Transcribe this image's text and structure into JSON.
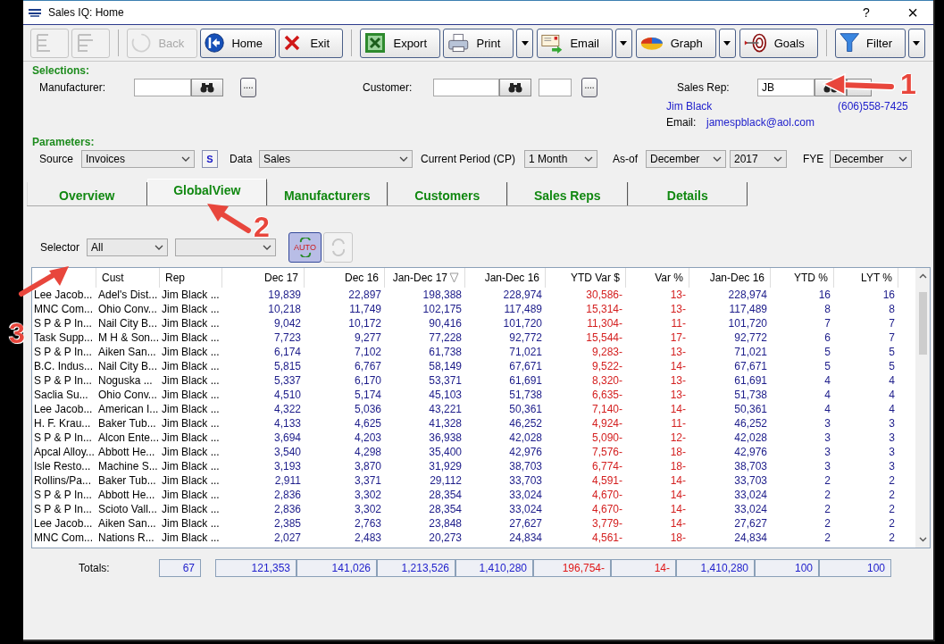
{
  "window": {
    "title": "Sales IQ: Home",
    "help": "?",
    "close": "×"
  },
  "toolbar": [
    {
      "kind": "button",
      "disabled": true,
      "menu": false
    },
    {
      "kind": "button",
      "disabled": true,
      "menu": false
    },
    {
      "kind": "separator"
    },
    {
      "kind": "button",
      "label": "Back",
      "disabled": true,
      "menu": false
    },
    {
      "kind": "button",
      "label": "Home",
      "disabled": false,
      "menu": false
    },
    {
      "kind": "button",
      "label": "Exit",
      "disabled": false,
      "menu": false
    },
    {
      "kind": "separator"
    },
    {
      "kind": "button",
      "label": "Export",
      "disabled": false,
      "menu": false
    },
    {
      "kind": "button",
      "label": "Print",
      "disabled": false,
      "menu": true
    },
    {
      "kind": "button",
      "label": "Email",
      "disabled": false,
      "menu": true
    },
    {
      "kind": "button",
      "label": "Graph",
      "disabled": false,
      "menu": true
    },
    {
      "kind": "button",
      "label": "Goals",
      "disabled": false,
      "menu": false
    },
    {
      "kind": "separator"
    },
    {
      "kind": "button",
      "label": "Filter",
      "disabled": false,
      "menu": true
    }
  ],
  "selections": {
    "title": "Selections:",
    "manufacturer": {
      "label": "Manufacturer:",
      "more": "...."
    },
    "customer": {
      "label": "Customer:",
      "more": "...."
    },
    "sales_rep": {
      "label": "Sales Rep:",
      "value": "JB"
    },
    "rep_name": "Jim Black",
    "rep_phone": "(606)558-7425",
    "email_label": "Email:",
    "email": "jamespblack@aol.com"
  },
  "parameters": {
    "title": "Parameters:",
    "fields": [
      {
        "kind": "select",
        "label": "Source",
        "value": "Invoices"
      },
      {
        "kind": "button",
        "label": "S"
      },
      {
        "kind": "select",
        "label": "Data",
        "value": "Sales"
      },
      {
        "kind": "select",
        "label": "Current Period (CP)",
        "value": "1 Month"
      },
      {
        "kind": "select",
        "label": "As-of",
        "value": "December"
      },
      {
        "kind": "select",
        "value": "2017"
      },
      {
        "kind": "select",
        "label": "FYE",
        "value": "December"
      }
    ]
  },
  "tabs": [
    {
      "label": "Overview",
      "selected": false
    },
    {
      "label": "GlobalView",
      "selected": true
    },
    {
      "label": "Manufacturers",
      "selected": false
    },
    {
      "label": "Customers",
      "selected": false
    },
    {
      "label": "Sales Reps",
      "selected": false
    },
    {
      "label": "Details",
      "selected": false
    }
  ],
  "selector": {
    "label": "Selector",
    "value": "All",
    "auto": {
      "label": "AUTO",
      "pressed": true
    },
    "refresh": {
      "disabled": true
    }
  },
  "table": {
    "columns": [
      {
        "kind": "text"
      },
      {
        "kind": "text",
        "label": "Cust",
        "sorted": false
      },
      {
        "kind": "text",
        "label": "Rep",
        "sorted": false
      },
      {
        "kind": "number",
        "label": "Dec 17",
        "sorted": false
      },
      {
        "kind": "number",
        "label": "Dec 16",
        "sorted": false
      },
      {
        "kind": "number",
        "label": "Jan-Dec 17",
        "sorted": true
      },
      {
        "kind": "number",
        "label": "Jan-Dec 16",
        "sorted": false
      },
      {
        "kind": "variance",
        "label": "YTD Var $",
        "sorted": false
      },
      {
        "kind": "variance",
        "label": "Var %",
        "sorted": false
      },
      {
        "kind": "number",
        "label": "Jan-Dec 16",
        "sorted": false
      },
      {
        "kind": "number",
        "label": "YTD %",
        "sorted": false
      },
      {
        "kind": "number",
        "label": "LYT %",
        "sorted": false
      }
    ],
    "rows": [
      [
        "Lee Jacob...",
        "Adel's Dist...",
        "Jim Black ...",
        "19,839",
        "22,897",
        "198,388",
        "228,974",
        "30,586-",
        "13-",
        "228,974",
        "16",
        "16"
      ],
      [
        "MNC Com...",
        "Ohio Conv...",
        "Jim Black ...",
        "10,218",
        "11,749",
        "102,175",
        "117,489",
        "15,314-",
        "13-",
        "117,489",
        "8",
        "8"
      ],
      [
        "S P & P In...",
        "Nail City B...",
        "Jim Black ...",
        "9,042",
        "10,172",
        "90,416",
        "101,720",
        "11,304-",
        "11-",
        "101,720",
        "7",
        "7"
      ],
      [
        "Task Supp...",
        "M H & Son...",
        "Jim Black ...",
        "7,723",
        "9,277",
        "77,228",
        "92,772",
        "15,544-",
        "17-",
        "92,772",
        "6",
        "7"
      ],
      [
        "S P & P In...",
        "Aiken San...",
        "Jim Black ...",
        "6,174",
        "7,102",
        "61,738",
        "71,021",
        "9,283-",
        "13-",
        "71,021",
        "5",
        "5"
      ],
      [
        "B.C. Indus...",
        "Nail City B...",
        "Jim Black ...",
        "5,815",
        "6,767",
        "58,149",
        "67,671",
        "9,522-",
        "14-",
        "67,671",
        "5",
        "5"
      ],
      [
        "S P & P In...",
        "Noguska  ...",
        "Jim Black ...",
        "5,337",
        "6,170",
        "53,371",
        "61,691",
        "8,320-",
        "13-",
        "61,691",
        "4",
        "4"
      ],
      [
        "Saclia Su...",
        "Ohio Conv...",
        "Jim Black ...",
        "4,510",
        "5,174",
        "45,103",
        "51,738",
        "6,635-",
        "13-",
        "51,738",
        "4",
        "4"
      ],
      [
        "Lee Jacob...",
        "American I...",
        "Jim Black ...",
        "4,322",
        "5,036",
        "43,221",
        "50,361",
        "7,140-",
        "14-",
        "50,361",
        "4",
        "4"
      ],
      [
        "H. F. Krau...",
        "Baker Tub...",
        "Jim Black ...",
        "4,133",
        "4,625",
        "41,328",
        "46,252",
        "4,924-",
        "11-",
        "46,252",
        "3",
        "3"
      ],
      [
        "S P & P In...",
        "Alcon Ente...",
        "Jim Black ...",
        "3,694",
        "4,203",
        "36,938",
        "42,028",
        "5,090-",
        "12-",
        "42,028",
        "3",
        "3"
      ],
      [
        "Apcal Alloy...",
        "Abbott He...",
        "Jim Black ...",
        "3,540",
        "4,298",
        "35,400",
        "42,976",
        "7,576-",
        "18-",
        "42,976",
        "3",
        "3"
      ],
      [
        "Isle Resto...",
        "Machine S...",
        "Jim Black ...",
        "3,193",
        "3,870",
        "31,929",
        "38,703",
        "6,774-",
        "18-",
        "38,703",
        "3",
        "3"
      ],
      [
        "Rollins/Pa...",
        "Baker Tub...",
        "Jim Black ...",
        "2,911",
        "3,371",
        "29,112",
        "33,703",
        "4,591-",
        "14-",
        "33,703",
        "2",
        "2"
      ],
      [
        "S P & P In...",
        "Abbott He...",
        "Jim Black ...",
        "2,836",
        "3,302",
        "28,354",
        "33,024",
        "4,670-",
        "14-",
        "33,024",
        "2",
        "2"
      ],
      [
        "S P & P In...",
        "Scioto Vall...",
        "Jim Black ...",
        "2,836",
        "3,302",
        "28,354",
        "33,024",
        "4,670-",
        "14-",
        "33,024",
        "2",
        "2"
      ],
      [
        "Lee Jacob...",
        "Aiken San...",
        "Jim Black ...",
        "2,385",
        "2,763",
        "23,848",
        "27,627",
        "3,779-",
        "14-",
        "27,627",
        "2",
        "2"
      ],
      [
        "MNC Com...",
        "Nations R...",
        "Jim Black ...",
        "2,027",
        "2,483",
        "20,273",
        "24,834",
        "4,561-",
        "18-",
        "24,834",
        "2",
        "2"
      ]
    ]
  },
  "totals": {
    "label": "Totals:",
    "count": "67",
    "cells": [
      {
        "kind": "number",
        "value": "121,353"
      },
      {
        "kind": "number",
        "value": "141,026"
      },
      {
        "kind": "number",
        "value": "1,213,526"
      },
      {
        "kind": "number",
        "value": "1,410,280"
      },
      {
        "kind": "variance",
        "value": "196,754-"
      },
      {
        "kind": "variance",
        "value": "14-"
      },
      {
        "kind": "number",
        "value": "1,410,280"
      },
      {
        "kind": "number",
        "value": "100"
      },
      {
        "kind": "number",
        "value": "100"
      }
    ]
  },
  "annotations": [
    {
      "label": "1"
    },
    {
      "label": "2"
    },
    {
      "label": "3"
    }
  ]
}
